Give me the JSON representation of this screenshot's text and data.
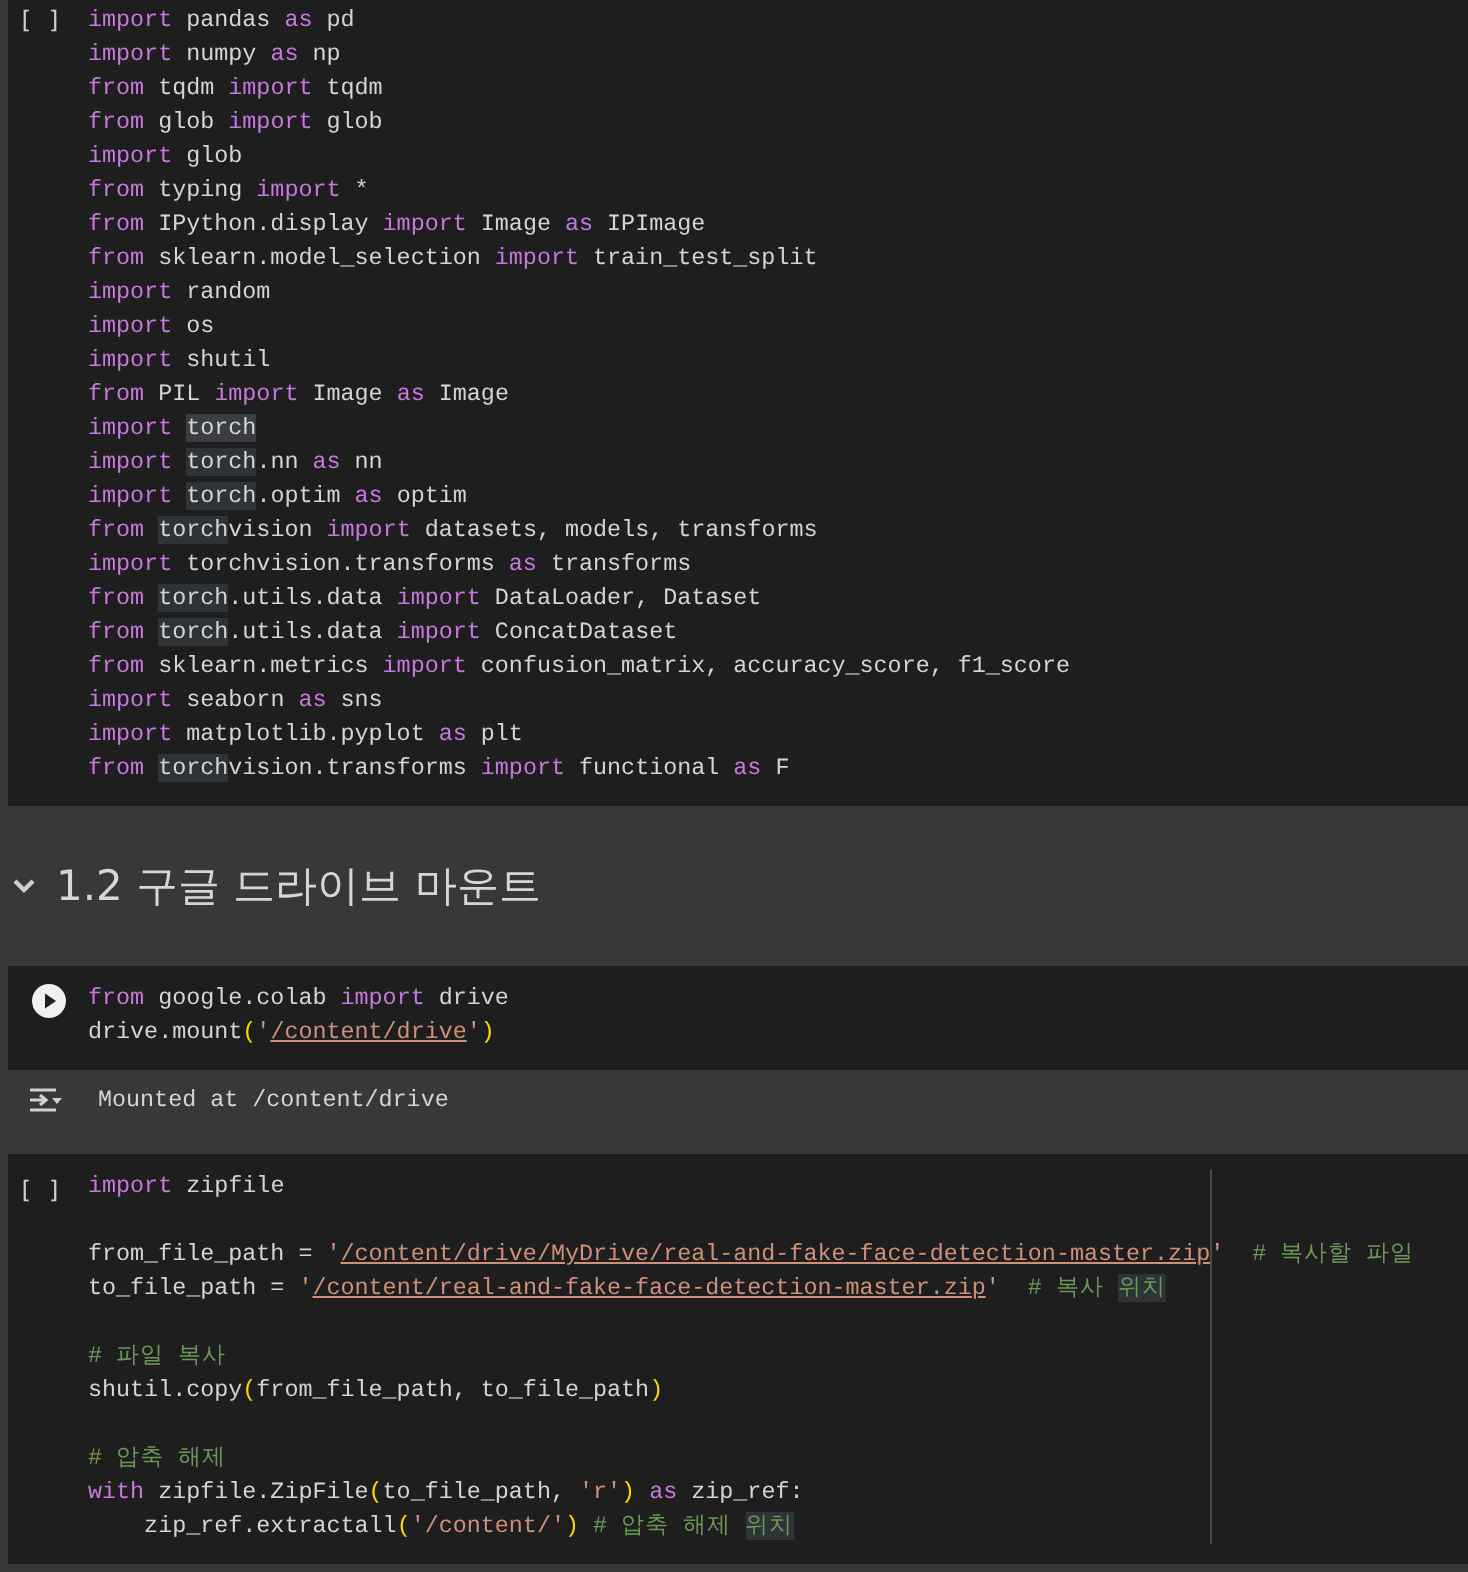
{
  "cells": [
    {
      "kind": "code",
      "status": "[ ]",
      "lines": [
        {
          "tokens": [
            {
              "kind": "kw",
              "text": "import"
            },
            {
              "kind": "text",
              "text": " pandas "
            },
            {
              "kind": "kw",
              "text": "as"
            },
            {
              "kind": "text",
              "text": " pd"
            }
          ]
        },
        {
          "tokens": [
            {
              "kind": "kw",
              "text": "import"
            },
            {
              "kind": "text",
              "text": " numpy "
            },
            {
              "kind": "kw",
              "text": "as"
            },
            {
              "kind": "text",
              "text": " np"
            }
          ]
        },
        {
          "tokens": [
            {
              "kind": "kw",
              "text": "from"
            },
            {
              "kind": "text",
              "text": " tqdm "
            },
            {
              "kind": "kw",
              "text": "import"
            },
            {
              "kind": "text",
              "text": " tqdm"
            }
          ]
        },
        {
          "tokens": [
            {
              "kind": "kw",
              "text": "from"
            },
            {
              "kind": "text",
              "text": " glob "
            },
            {
              "kind": "kw",
              "text": "import"
            },
            {
              "kind": "text",
              "text": " glob"
            }
          ]
        },
        {
          "tokens": [
            {
              "kind": "kw",
              "text": "import"
            },
            {
              "kind": "text",
              "text": " glob"
            }
          ]
        },
        {
          "tokens": [
            {
              "kind": "kw",
              "text": "from"
            },
            {
              "kind": "text",
              "text": " typing "
            },
            {
              "kind": "kw",
              "text": "import"
            },
            {
              "kind": "text",
              "text": " *"
            }
          ]
        },
        {
          "tokens": [
            {
              "kind": "kw",
              "text": "from"
            },
            {
              "kind": "text",
              "text": " IPython.display "
            },
            {
              "kind": "kw",
              "text": "import"
            },
            {
              "kind": "text",
              "text": " Image "
            },
            {
              "kind": "kw",
              "text": "as"
            },
            {
              "kind": "text",
              "text": " IPImage"
            }
          ]
        },
        {
          "tokens": [
            {
              "kind": "kw",
              "text": "from"
            },
            {
              "kind": "text",
              "text": " sklearn.model_selection "
            },
            {
              "kind": "kw",
              "text": "import"
            },
            {
              "kind": "text",
              "text": " train_test_split"
            }
          ]
        },
        {
          "tokens": [
            {
              "kind": "kw",
              "text": "import"
            },
            {
              "kind": "text",
              "text": " random"
            }
          ]
        },
        {
          "tokens": [
            {
              "kind": "kw",
              "text": "import"
            },
            {
              "kind": "text",
              "text": " os"
            }
          ]
        },
        {
          "tokens": [
            {
              "kind": "kw",
              "text": "import"
            },
            {
              "kind": "text",
              "text": " shutil"
            }
          ]
        },
        {
          "tokens": [
            {
              "kind": "kw",
              "text": "from"
            },
            {
              "kind": "text",
              "text": " PIL "
            },
            {
              "kind": "kw",
              "text": "import"
            },
            {
              "kind": "text",
              "text": " Image "
            },
            {
              "kind": "kw",
              "text": "as"
            },
            {
              "kind": "text",
              "text": " Image"
            }
          ]
        },
        {
          "tokens": [
            {
              "kind": "kw",
              "text": "import "
            },
            {
              "kind": "selected",
              "text": "torch"
            }
          ]
        },
        {
          "tokens": [
            {
              "kind": "kw",
              "text": "import "
            },
            {
              "kind": "match",
              "text": "torch"
            },
            {
              "kind": "text",
              "text": ".nn "
            },
            {
              "kind": "kw",
              "text": "as"
            },
            {
              "kind": "text",
              "text": " nn"
            }
          ]
        },
        {
          "tokens": [
            {
              "kind": "kw",
              "text": "import "
            },
            {
              "kind": "match",
              "text": "torch"
            },
            {
              "kind": "text",
              "text": ".optim "
            },
            {
              "kind": "kw",
              "text": "as"
            },
            {
              "kind": "text",
              "text": " optim"
            }
          ]
        },
        {
          "tokens": [
            {
              "kind": "kw",
              "text": "from "
            },
            {
              "kind": "match",
              "text": "torch"
            },
            {
              "kind": "text",
              "text": "vision "
            },
            {
              "kind": "kw",
              "text": "import"
            },
            {
              "kind": "text",
              "text": " datasets, models, transforms"
            }
          ]
        },
        {
          "tokens": [
            {
              "kind": "kw",
              "text": "import"
            },
            {
              "kind": "text",
              "text": " torchvision.transforms "
            },
            {
              "kind": "kw",
              "text": "as"
            },
            {
              "kind": "text",
              "text": " transforms"
            }
          ]
        },
        {
          "tokens": [
            {
              "kind": "kw",
              "text": "from "
            },
            {
              "kind": "match",
              "text": "torch"
            },
            {
              "kind": "text",
              "text": ".utils.data "
            },
            {
              "kind": "kw",
              "text": "import"
            },
            {
              "kind": "text",
              "text": " DataLoader, Dataset"
            }
          ]
        },
        {
          "tokens": [
            {
              "kind": "kw",
              "text": "from "
            },
            {
              "kind": "match",
              "text": "torch"
            },
            {
              "kind": "text",
              "text": ".utils.data "
            },
            {
              "kind": "kw",
              "text": "import"
            },
            {
              "kind": "text",
              "text": " ConcatDataset"
            }
          ]
        },
        {
          "tokens": [
            {
              "kind": "kw",
              "text": "from"
            },
            {
              "kind": "text",
              "text": " sklearn.metrics "
            },
            {
              "kind": "kw",
              "text": "import"
            },
            {
              "kind": "text",
              "text": " confusion_matrix, accuracy_score, f1_score"
            }
          ]
        },
        {
          "tokens": [
            {
              "kind": "kw",
              "text": "import"
            },
            {
              "kind": "text",
              "text": " seaborn "
            },
            {
              "kind": "kw",
              "text": "as"
            },
            {
              "kind": "text",
              "text": " sns"
            }
          ]
        },
        {
          "tokens": [
            {
              "kind": "kw",
              "text": "import"
            },
            {
              "kind": "text",
              "text": " matplotlib.pyplot "
            },
            {
              "kind": "kw",
              "text": "as"
            },
            {
              "kind": "text",
              "text": " plt"
            }
          ]
        },
        {
          "tokens": [
            {
              "kind": "kw",
              "text": "from "
            },
            {
              "kind": "match",
              "text": "torch"
            },
            {
              "kind": "text",
              "text": "vision.transforms "
            },
            {
              "kind": "kw",
              "text": "import"
            },
            {
              "kind": "text",
              "text": " functional "
            },
            {
              "kind": "kw",
              "text": "as"
            },
            {
              "kind": "text",
              "text": " F"
            }
          ]
        }
      ]
    },
    {
      "kind": "heading",
      "expanded": true,
      "text": "1.2 구글 드라이브 마운트"
    },
    {
      "kind": "code",
      "run_button": true,
      "lines": [
        {
          "tokens": [
            {
              "kind": "kw",
              "text": "from"
            },
            {
              "kind": "text",
              "text": " google.colab "
            },
            {
              "kind": "kw",
              "text": "import"
            },
            {
              "kind": "text",
              "text": " drive"
            }
          ]
        },
        {
          "tokens": [
            {
              "kind": "text",
              "text": "drive.mount"
            },
            {
              "kind": "paren",
              "text": "("
            },
            {
              "kind": "quote",
              "text": "'"
            },
            {
              "kind": "link",
              "text": "/content/drive"
            },
            {
              "kind": "quote",
              "text": "'"
            },
            {
              "kind": "paren",
              "text": ")"
            }
          ]
        }
      ]
    },
    {
      "kind": "output",
      "text": "Mounted at /content/drive"
    },
    {
      "kind": "code",
      "status": "[ ]",
      "ruler": true,
      "lines": [
        {
          "tokens": [
            {
              "kind": "kw",
              "text": "import"
            },
            {
              "kind": "text",
              "text": " zipfile"
            }
          ]
        },
        {
          "kind": "blank"
        },
        {
          "tokens": [
            {
              "kind": "text",
              "text": "from_file_path = "
            },
            {
              "kind": "quote",
              "text": "'"
            },
            {
              "kind": "link",
              "text": "/content/drive/MyDrive/real-and-fake-face-detection-master.zip"
            },
            {
              "kind": "quote",
              "text": "'"
            },
            {
              "kind": "comment",
              "text": "  # 복사할 파일"
            }
          ]
        },
        {
          "tokens": [
            {
              "kind": "text",
              "text": "to_file_path = "
            },
            {
              "kind": "quote",
              "text": "'"
            },
            {
              "kind": "link",
              "text": "/content/real-and-fake-face-detection-master.zip"
            },
            {
              "kind": "quote",
              "text": "'"
            },
            {
              "kind": "comment",
              "text": "  # 복사 "
            },
            {
              "kind": "comment_match",
              "text": "위치"
            }
          ]
        },
        {
          "kind": "blank"
        },
        {
          "tokens": [
            {
              "kind": "comment",
              "text": "# 파일 복사"
            }
          ]
        },
        {
          "tokens": [
            {
              "kind": "text",
              "text": "shutil.copy"
            },
            {
              "kind": "paren",
              "text": "("
            },
            {
              "kind": "text",
              "text": "from_file_path, to_file_path"
            },
            {
              "kind": "paren",
              "text": ")"
            }
          ]
        },
        {
          "kind": "blank"
        },
        {
          "tokens": [
            {
              "kind": "comment",
              "text": "# 압축 해제"
            }
          ]
        },
        {
          "tokens": [
            {
              "kind": "kw",
              "text": "with"
            },
            {
              "kind": "text",
              "text": " zipfile.ZipFile"
            },
            {
              "kind": "paren",
              "text": "("
            },
            {
              "kind": "text",
              "text": "to_file_path, "
            },
            {
              "kind": "quote",
              "text": "'r'"
            },
            {
              "kind": "paren",
              "text": ")"
            },
            {
              "kind": "kw",
              "text": " as"
            },
            {
              "kind": "text",
              "text": " zip_ref:"
            }
          ]
        },
        {
          "tokens": [
            {
              "kind": "text",
              "text": "    zip_ref.extractall"
            },
            {
              "kind": "paren",
              "text": "("
            },
            {
              "kind": "quote",
              "text": "'/content/'"
            },
            {
              "kind": "paren",
              "text": ")"
            },
            {
              "kind": "comment",
              "text": " # 압축 해제 "
            },
            {
              "kind": "comment_match",
              "text": "위치"
            }
          ]
        }
      ]
    }
  ]
}
